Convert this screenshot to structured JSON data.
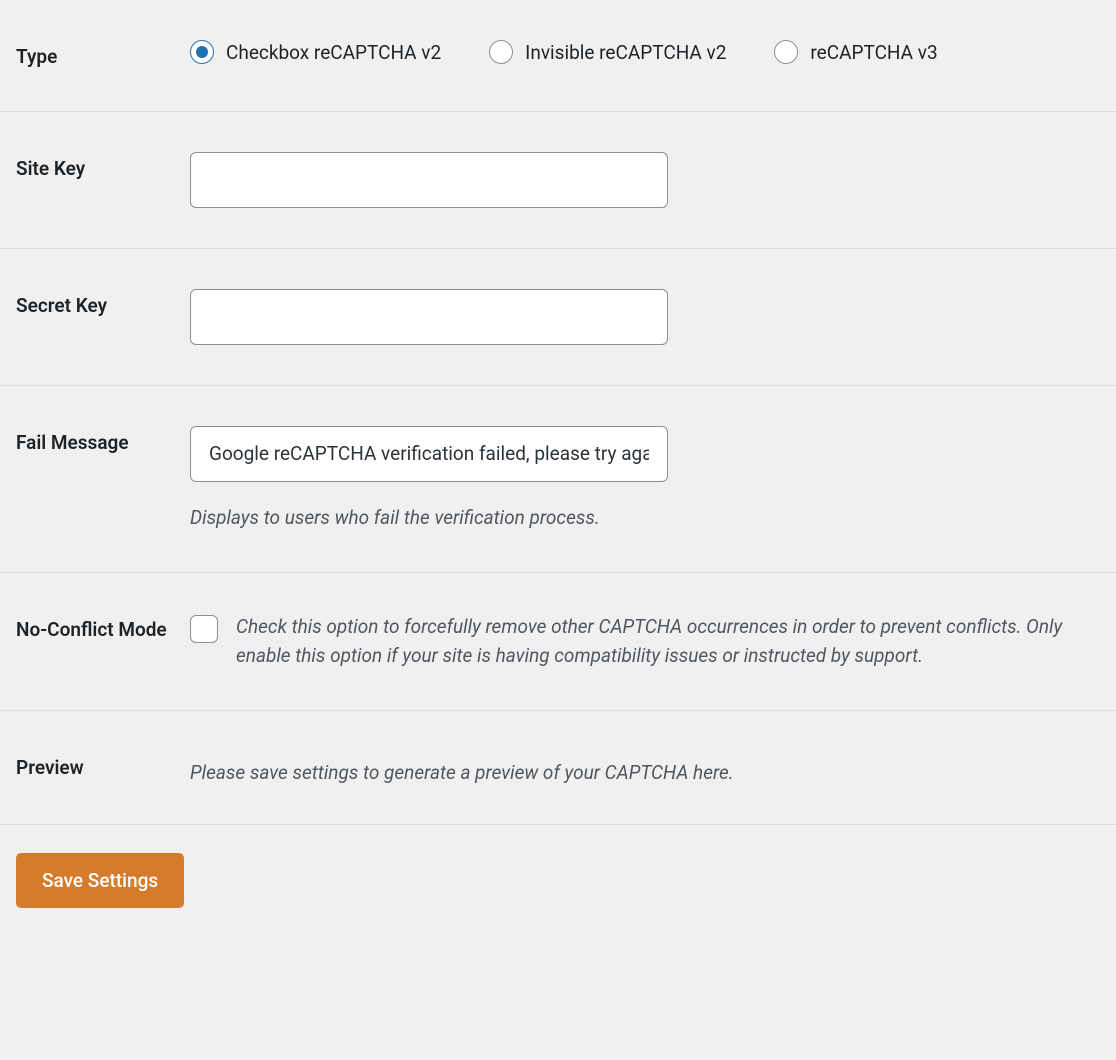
{
  "rows": {
    "type": {
      "label": "Type",
      "options": [
        {
          "label": "Checkbox reCAPTCHA v2",
          "checked": true
        },
        {
          "label": "Invisible reCAPTCHA v2",
          "checked": false
        },
        {
          "label": "reCAPTCHA v3",
          "checked": false
        }
      ]
    },
    "site_key": {
      "label": "Site Key",
      "value": ""
    },
    "secret_key": {
      "label": "Secret Key",
      "value": ""
    },
    "fail_message": {
      "label": "Fail Message",
      "value": "Google reCAPTCHA verification failed, please try again later.",
      "description": "Displays to users who fail the verification process."
    },
    "no_conflict": {
      "label": "No-Conflict Mode",
      "checked": false,
      "description": "Check this option to forcefully remove other CAPTCHA occurrences in order to prevent conflicts. Only enable this option if your site is having compatibility issues or instructed by support."
    },
    "preview": {
      "label": "Preview",
      "text": "Please save settings to generate a preview of your CAPTCHA here."
    }
  },
  "submit": {
    "label": "Save Settings"
  }
}
